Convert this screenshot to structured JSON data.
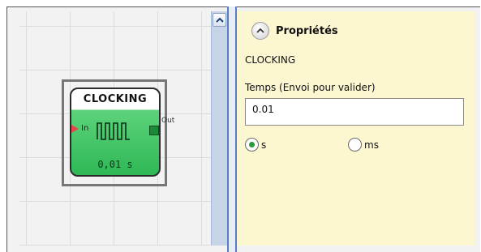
{
  "canvas": {
    "block": {
      "title": "CLOCKING",
      "input_label": "In",
      "output_label": "Out",
      "value": "0,01 s"
    }
  },
  "properties": {
    "title": "Propriétés",
    "block_name": "CLOCKING",
    "time_field": {
      "label": "Temps (Envoi pour valider)",
      "value": "0.01"
    },
    "units": [
      {
        "label": "s",
        "selected": true
      },
      {
        "label": "ms",
        "selected": false
      }
    ]
  },
  "colors": {
    "block_green": "#2fb856",
    "panel_background": "#fcf7d0",
    "input_arrow": "#e34848",
    "radio_selected": "#2a9b3a"
  },
  "icons": {
    "scroll_up": "chevron-up-icon",
    "collapse": "chevron-up-icon",
    "pulse": "clock-pulse-icon"
  }
}
